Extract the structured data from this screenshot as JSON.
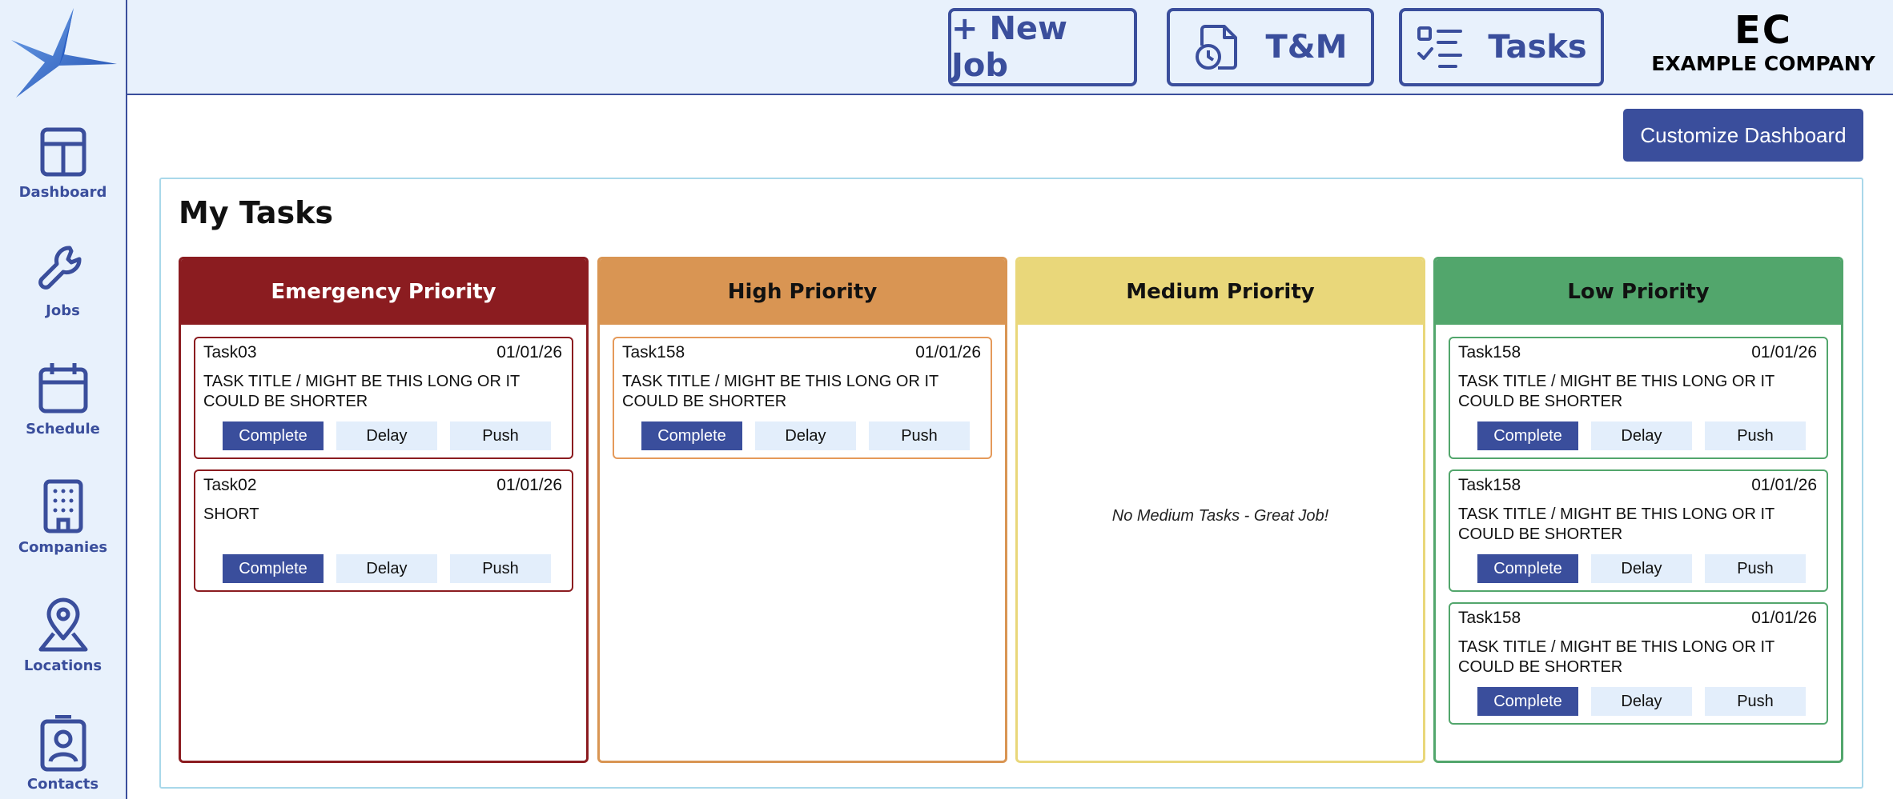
{
  "colors": {
    "brand": "#3a4e9c",
    "sidebar_bg": "#e8f1fc",
    "emergency": "#8b1c20",
    "high": "#d99553",
    "medium": "#e9d77a",
    "low": "#52a66c"
  },
  "sidebar": {
    "logo": "company-logo",
    "items": [
      {
        "label": "Dashboard",
        "icon": "dashboard-icon"
      },
      {
        "label": "Jobs",
        "icon": "wrench-icon"
      },
      {
        "label": "Schedule",
        "icon": "calendar-icon"
      },
      {
        "label": "Companies",
        "icon": "building-icon"
      },
      {
        "label": "Locations",
        "icon": "map-pin-icon"
      },
      {
        "label": "Contacts",
        "icon": "contact-card-icon"
      }
    ]
  },
  "header": {
    "new_job": "+ New Job",
    "tm": "T&M",
    "tasks": "Tasks",
    "brand_short": "EC",
    "brand_name": "EXAMPLE COMPANY"
  },
  "customize_label": "Customize Dashboard",
  "panel": {
    "title": "My Tasks",
    "columns": [
      {
        "title": "Emergency Priority",
        "tasks": [
          {
            "id": "Task03",
            "date": "01/01/26",
            "title": "TASK TITLE / MIGHT BE THIS LONG OR IT COULD BE SHORTER"
          },
          {
            "id": "Task02",
            "date": "01/01/26",
            "title": "SHORT"
          }
        ]
      },
      {
        "title": "High Priority",
        "tasks": [
          {
            "id": "Task158",
            "date": "01/01/26",
            "title": "TASK TITLE / MIGHT BE THIS LONG OR IT COULD BE SHORTER"
          }
        ]
      },
      {
        "title": "Medium Priority",
        "tasks": [],
        "empty_message": "No Medium Tasks - Great Job!"
      },
      {
        "title": "Low Priority",
        "tasks": [
          {
            "id": "Task158",
            "date": "01/01/26",
            "title": "TASK TITLE / MIGHT BE THIS LONG OR IT COULD BE SHORTER"
          },
          {
            "id": "Task158",
            "date": "01/01/26",
            "title": "TASK TITLE / MIGHT BE THIS LONG OR IT COULD BE SHORTER"
          },
          {
            "id": "Task158",
            "date": "01/01/26",
            "title": "TASK TITLE / MIGHT BE THIS LONG OR IT COULD BE SHORTER"
          }
        ]
      }
    ],
    "actions": {
      "complete": "Complete",
      "delay": "Delay",
      "push": "Push"
    }
  }
}
